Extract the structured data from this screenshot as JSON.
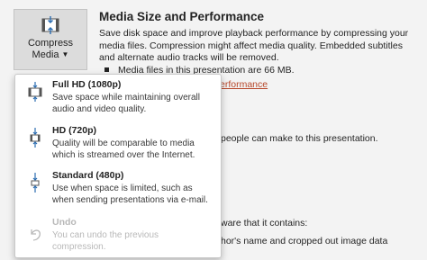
{
  "compress_button": {
    "line1": "Compress",
    "line2": "Media"
  },
  "heading": "Media Size and Performance",
  "description": "Save disk space and improve playback performance by compressing your media files. Compression might affect media quality. Embedded subtitles and alternate audio tracks will be removed.",
  "bullets": {
    "size": "Media files in this presentation are 66 MB.",
    "link_tail": "erformance"
  },
  "background_fragments": {
    "people": "people can make to this presentation.",
    "aware": "ware that it contains:",
    "author": "hor's name and cropped out image data"
  },
  "menu": {
    "items": [
      {
        "title": "Full HD (1080p)",
        "description": "Save space while maintaining overall audio and video quality."
      },
      {
        "title": "HD (720p)",
        "description": "Quality will be comparable to media which is streamed over the Internet."
      },
      {
        "title": "Standard (480p)",
        "description": "Use when space is limited, such as when sending presentations via e-mail."
      },
      {
        "title": "Undo",
        "description": "You can undo the previous compression."
      }
    ]
  },
  "colors": {
    "link": "#b7472a",
    "accent_blue": "#2b6cb0",
    "disabled_text": "#b8b8b8"
  },
  "icons": [
    "compress-media-icon",
    "chevron-down-icon",
    "full-hd-compress-icon",
    "hd-compress-icon",
    "standard-compress-icon",
    "undo-icon"
  ]
}
